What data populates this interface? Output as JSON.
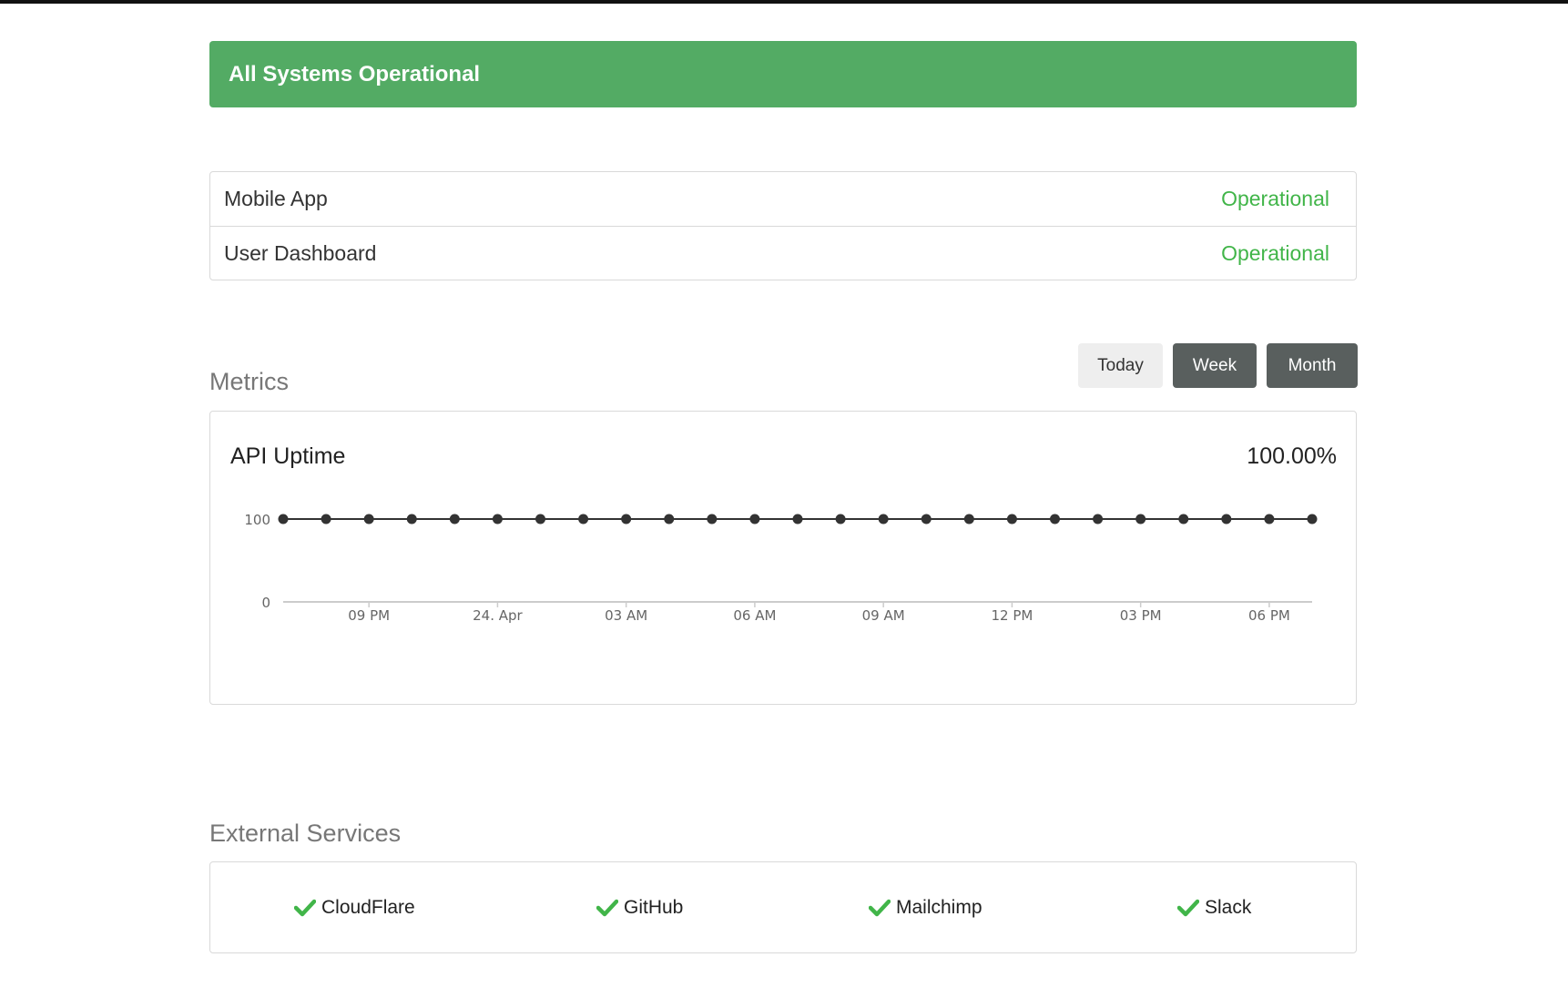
{
  "banner": {
    "text": "All Systems Operational",
    "color": "#53ab64"
  },
  "components": [
    {
      "name": "Mobile App",
      "status": "Operational"
    },
    {
      "name": "User Dashboard",
      "status": "Operational"
    }
  ],
  "metrics": {
    "title": "Metrics",
    "range_buttons": [
      "Today",
      "Week",
      "Month"
    ],
    "card": {
      "name": "API Uptime",
      "value": "100.00%"
    }
  },
  "chart_data": {
    "type": "line",
    "y_ticks": [
      "100",
      "0"
    ],
    "ylim": [
      0,
      100
    ],
    "x_tick_labels": [
      "09 PM",
      "24. Apr",
      "03 AM",
      "06 AM",
      "09 AM",
      "12 PM",
      "03 PM",
      "06 PM"
    ],
    "values": [
      100,
      100,
      100,
      100,
      100,
      100,
      100,
      100,
      100,
      100,
      100,
      100,
      100,
      100,
      100,
      100,
      100,
      100,
      100,
      100,
      100,
      100,
      100,
      100,
      100
    ],
    "grid": false,
    "line_color": "#333333"
  },
  "external": {
    "title": "External Services",
    "services": [
      {
        "name": "CloudFlare",
        "icon": "check-icon"
      },
      {
        "name": "GitHub",
        "icon": "check-icon"
      },
      {
        "name": "Mailchimp",
        "icon": "check-icon"
      },
      {
        "name": "Slack",
        "icon": "check-icon"
      }
    ],
    "check_color": "#41b549"
  },
  "status_color": "#41b549"
}
